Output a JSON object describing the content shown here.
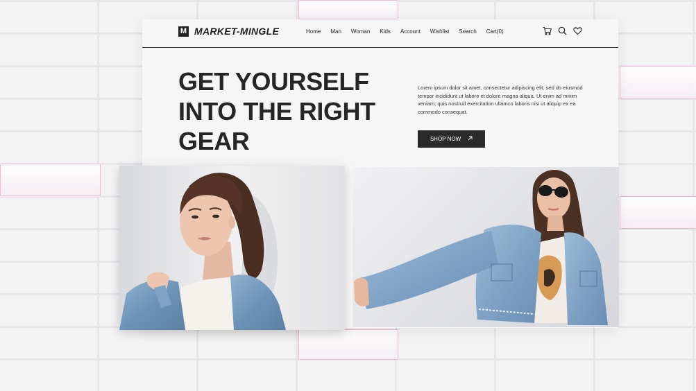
{
  "brand": {
    "logo_letter": "M",
    "name": "MARKET-MINGLE"
  },
  "nav": {
    "links": [
      "Home",
      "Man",
      "Woman",
      "Kids",
      "Account",
      "Wishlist",
      "Search",
      "Cart(0)"
    ],
    "icons": [
      "cart-icon",
      "search-icon",
      "heart-icon"
    ]
  },
  "hero": {
    "headline_lines": [
      "GET YOURSELF",
      "INTO THE RIGHT",
      "GEAR"
    ],
    "blurb": "Lorem ipsum dolor sit amet, consectetur adipiscing elit, sed do eiusmod tempor incididunt ut labore et dolore magna aliqua. Ut enim ad minim veniam, quis nostrud exercitation ullamco laboris nisi ut aliquip ex ea commodo consequat.",
    "cta_label": "SHOP NOW",
    "cta_icon": "arrow-up-right-icon"
  },
  "colors": {
    "dark": "#262626",
    "accent_tile": "#f2b8d6",
    "card": "#f6f6f6"
  }
}
